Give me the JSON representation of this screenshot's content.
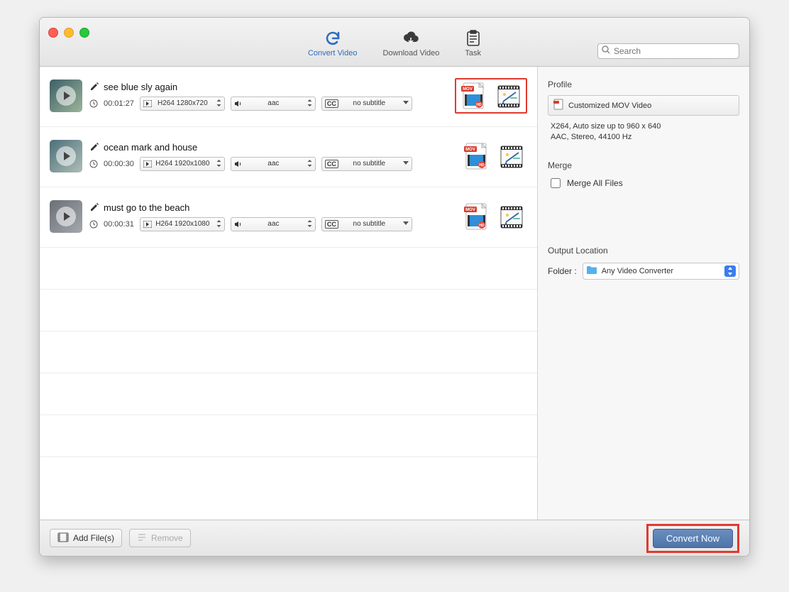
{
  "toolbar": {
    "tabs": [
      {
        "label": "Convert Video",
        "selected": true
      },
      {
        "label": "Download Video",
        "selected": false
      },
      {
        "label": "Task",
        "selected": false
      }
    ],
    "search_placeholder": "Search"
  },
  "items": [
    {
      "title": "see blue sly again",
      "duration": "00:01:27",
      "video_format": "H264 1280x720",
      "audio_format": "aac",
      "subtitle": "no subtitle",
      "highlighted": true
    },
    {
      "title": "ocean mark and house",
      "duration": "00:00:30",
      "video_format": "H264 1920x1080",
      "audio_format": "aac",
      "subtitle": "no subtitle",
      "highlighted": false
    },
    {
      "title": "must go to the beach",
      "duration": "00:00:31",
      "video_format": "H264 1920x1080",
      "audio_format": "aac",
      "subtitle": "no subtitle",
      "highlighted": false
    }
  ],
  "subtitle_prefix": "CC",
  "sidebar": {
    "profile_header": "Profile",
    "profile_name": "Customized MOV Video",
    "profile_details_line1": "X264, Auto size up to 960 x 640",
    "profile_details_line2": "AAC, Stereo, 44100 Hz",
    "merge_header": "Merge",
    "merge_checkbox_label": "Merge All Files",
    "merge_checked": false,
    "output_header": "Output Location",
    "folder_label": "Folder :",
    "folder_value": "Any Video Converter"
  },
  "footer": {
    "add_files_label": "Add File(s)",
    "remove_label": "Remove",
    "convert_label": "Convert Now"
  }
}
